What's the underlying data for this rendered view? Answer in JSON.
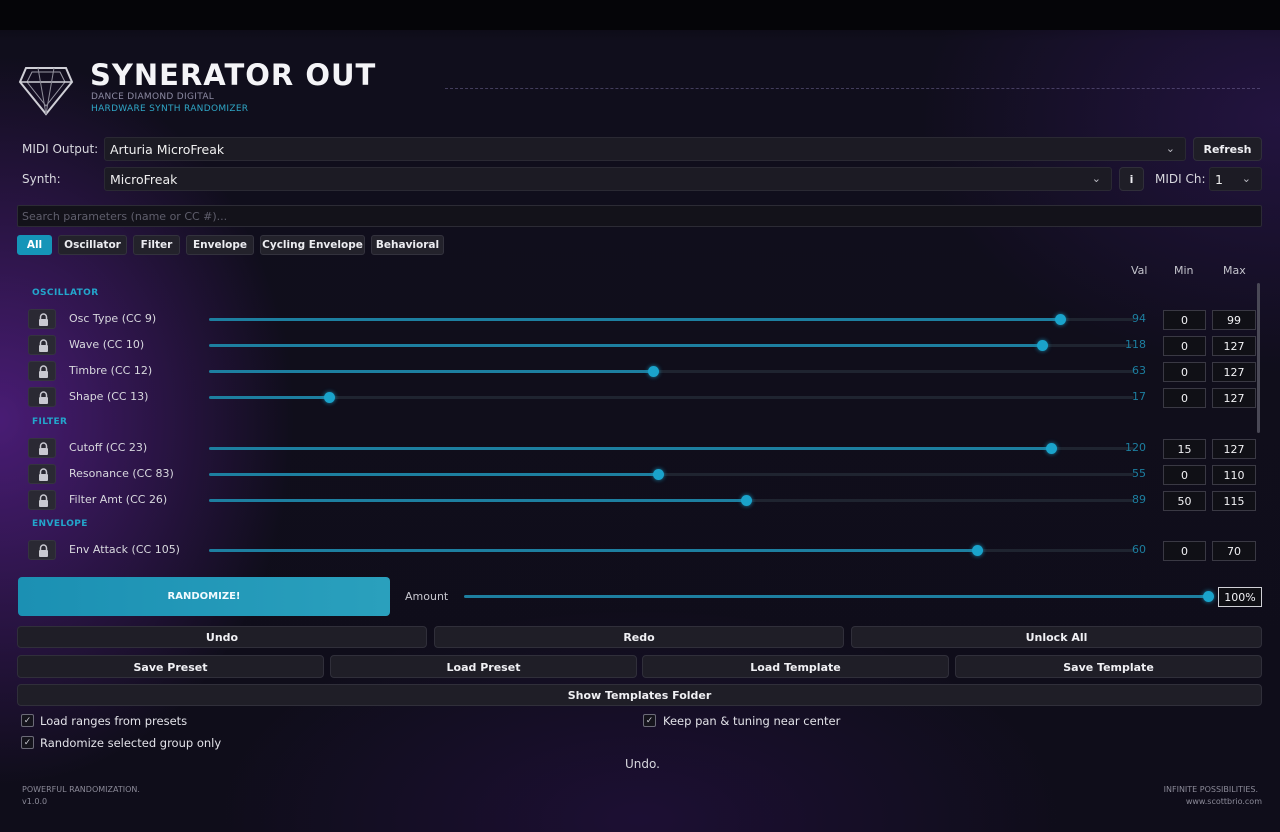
{
  "app": {
    "title": "SYNERATOR OUT",
    "subtitle1": "DANCE DIAMOND DIGITAL",
    "subtitle2": "HARDWARE SYNTH RANDOMIZER"
  },
  "midi": {
    "output_label": "MIDI Output:",
    "output_value": "Arturia MicroFreak",
    "refresh_label": "Refresh",
    "synth_label": "Synth:",
    "synth_value": "MicroFreak",
    "info_label": "i",
    "channel_label": "MIDI Ch:",
    "channel_value": "1"
  },
  "search": {
    "placeholder": "Search parameters (name or CC #)..."
  },
  "tabs": [
    {
      "label": "All",
      "active": true
    },
    {
      "label": "Oscillator"
    },
    {
      "label": "Filter"
    },
    {
      "label": "Envelope"
    },
    {
      "label": "Cycling Envelope"
    },
    {
      "label": "Behavioral"
    }
  ],
  "columns": {
    "val": "Val",
    "min": "Min",
    "max": "Max"
  },
  "sections": {
    "oscillator": "OSCILLATOR",
    "filter": "FILTER",
    "envelope": "ENVELOPE"
  },
  "params": [
    {
      "name": "Osc Type (CC 9)",
      "val": "94",
      "min": "0",
      "max": "99",
      "level": 0.92
    },
    {
      "name": "Wave (CC 10)",
      "val": "118",
      "min": "0",
      "max": "127",
      "level": 0.9
    },
    {
      "name": "Timbre (CC 12)",
      "val": "63",
      "min": "0",
      "max": "127",
      "level": 0.48
    },
    {
      "name": "Shape (CC 13)",
      "val": "17",
      "min": "0",
      "max": "127",
      "level": 0.13
    },
    {
      "name": "Cutoff (CC 23)",
      "val": "120",
      "min": "15",
      "max": "127",
      "level": 0.91
    },
    {
      "name": "Resonance (CC 83)",
      "val": "55",
      "min": "0",
      "max": "110",
      "level": 0.485
    },
    {
      "name": "Filter Amt (CC 26)",
      "val": "89",
      "min": "50",
      "max": "115",
      "level": 0.58
    },
    {
      "name": "Env Attack (CC 105)",
      "val": "60",
      "min": "0",
      "max": "70",
      "level": 0.83
    }
  ],
  "actions": {
    "randomize": "RANDOMIZE!",
    "amount_label": "Amount",
    "amount_value": "100%",
    "amount_level": 1.0,
    "undo": "Undo",
    "redo": "Redo",
    "unlock_all": "Unlock All",
    "save_preset": "Save Preset",
    "load_preset": "Load Preset",
    "load_template": "Load Template",
    "save_template": "Save Template",
    "show_templates": "Show Templates Folder"
  },
  "options": {
    "load_ranges": "Load ranges from presets",
    "randomize_group": "Randomize selected group only",
    "keep_pan": "Keep pan & tuning near center"
  },
  "status": "Undo.",
  "footer": {
    "left1": "POWERFUL RANDOMIZATION.",
    "left2": "v1.0.0",
    "right1": "INFINITE POSSIBILITIES.",
    "right2": "www.scottbrio.com"
  },
  "colors": {
    "accent": "#1595b8",
    "track": "#1d7fa0"
  }
}
